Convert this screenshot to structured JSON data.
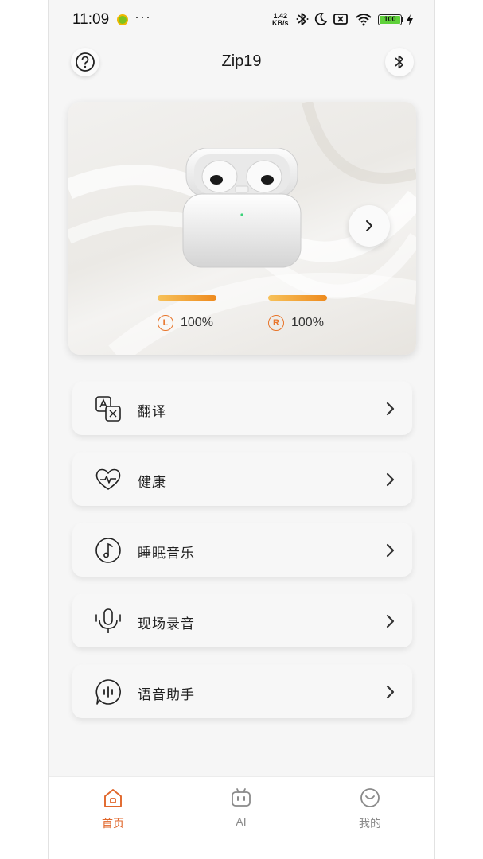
{
  "status_bar": {
    "time": "11:09",
    "more": "···",
    "speed_value": "1.42",
    "speed_unit": "KB/s",
    "battery": "100"
  },
  "header": {
    "title": "Zip19"
  },
  "device": {
    "left_prefix": "L",
    "left_battery": "100%",
    "left_level": 1.0,
    "right_prefix": "R",
    "right_battery": "100%",
    "right_level": 1.0
  },
  "menu": [
    {
      "label": "翻译",
      "icon": "translate-icon"
    },
    {
      "label": "健康",
      "icon": "heart-pulse-icon"
    },
    {
      "label": "睡眠音乐",
      "icon": "music-note-icon"
    },
    {
      "label": "现场录音",
      "icon": "microphone-icon"
    },
    {
      "label": "语音助手",
      "icon": "voice-assistant-icon"
    }
  ],
  "nav": {
    "home": "首页",
    "ai": "AI",
    "mine": "我的",
    "active_color": "#e0662a",
    "inactive_color": "#8a8a8a"
  },
  "colors": {
    "accent": "#e8752a",
    "battery_bar": "#ee8a1e"
  }
}
